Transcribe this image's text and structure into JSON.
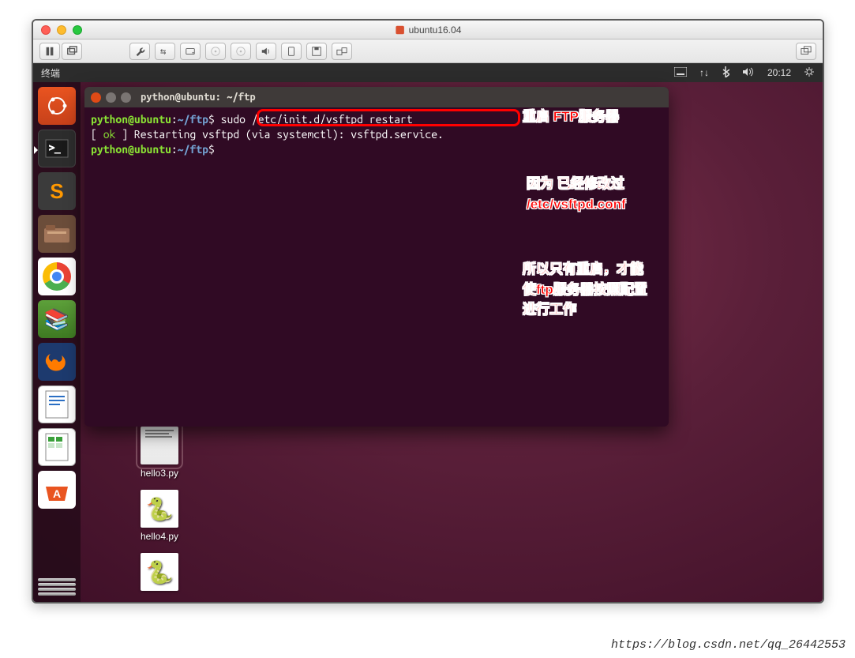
{
  "mac": {
    "title": "ubuntu16.04"
  },
  "vm_toolbar": {
    "icons": [
      "pause",
      "popup",
      "wrench",
      "network",
      "disk",
      "cd1",
      "cd2",
      "sound",
      "usb",
      "floppy",
      "share",
      "fullscreen"
    ]
  },
  "ubuntu_panel": {
    "app_name": "终端",
    "time": "20:12"
  },
  "launcher": [
    {
      "name": "dash",
      "label": "Dash"
    },
    {
      "name": "terminal",
      "label": "Terminal"
    },
    {
      "name": "sublime",
      "label": "Sublime"
    },
    {
      "name": "files",
      "label": "Files"
    },
    {
      "name": "chrome",
      "label": "Chrome"
    },
    {
      "name": "books",
      "label": "Books"
    },
    {
      "name": "firefox",
      "label": "Firefox"
    },
    {
      "name": "writer",
      "label": "Writer"
    },
    {
      "name": "calc",
      "label": "Calc"
    },
    {
      "name": "software",
      "label": "Software"
    }
  ],
  "desktop_files": {
    "hello3": "hello3.py",
    "hello4": "hello4.py"
  },
  "terminal": {
    "title": "python@ubuntu: ~/ftp",
    "prompt_user": "python@ubuntu",
    "prompt_path": "~/ftp",
    "command": "sudo /etc/init.d/vsftpd restart",
    "output_prefix": "[ ",
    "output_ok": "ok",
    "output_rest": " ] Restarting vsftpd (via systemctl): vsftpd.service."
  },
  "annotations": {
    "a1": "重启 FTP服务器",
    "a2": "因为 已经修改过 /etc/vsftpd.conf",
    "a3": "所以只有重启，才能使ftp服务器按照配置进行工作"
  },
  "watermark": "https://blog.csdn.net/qq_26442553"
}
